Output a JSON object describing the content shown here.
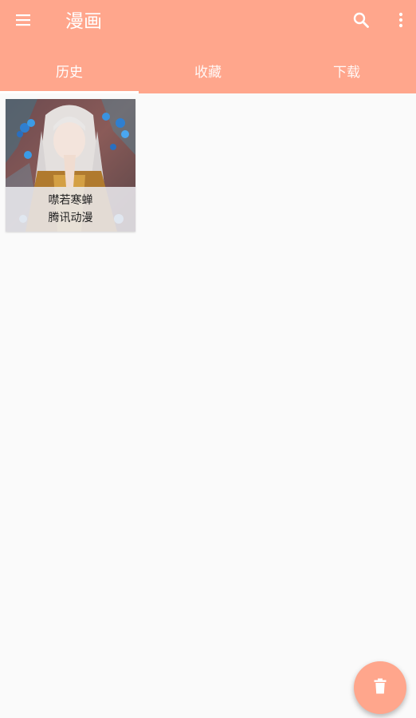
{
  "colors": {
    "primary": "#ffa68c",
    "text_on_primary": "#ffffff",
    "background": "#fafafa"
  },
  "toolbar": {
    "menu_icon": "menu-icon",
    "title": "漫画",
    "search_icon": "search-icon",
    "more_icon": "more-vert-icon"
  },
  "tabs": [
    {
      "label": "历史",
      "selected": true
    },
    {
      "label": "收藏",
      "selected": false
    },
    {
      "label": "下载",
      "selected": false
    }
  ],
  "comics": [
    {
      "title": "噤若寒蝉",
      "source": "腾讯动漫"
    }
  ],
  "fab": {
    "icon": "trash-icon"
  }
}
